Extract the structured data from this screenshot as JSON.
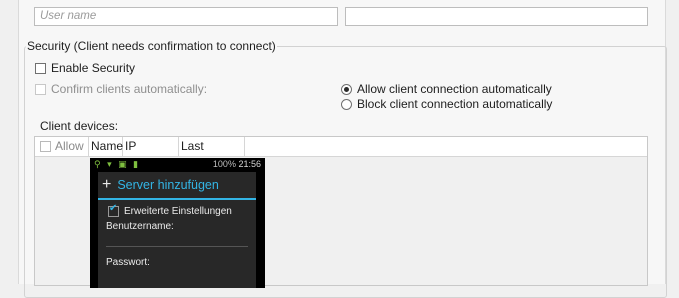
{
  "login": {
    "username_placeholder": "User name",
    "password_value": ""
  },
  "security": {
    "legend": "Security (Client needs confirmation to connect)",
    "enable_label": "Enable Security",
    "confirm_label": "Confirm clients automatically:",
    "radio_allow": "Allow client connection automatically",
    "radio_block": "Block client connection automatically"
  },
  "devices": {
    "label": "Client devices:",
    "columns": [
      "Allow",
      "Name",
      "IP address",
      "Last access"
    ]
  },
  "phone": {
    "time": "21:56",
    "battery": "100%",
    "title": "Server hinzufügen",
    "advanced": "Erweiterte Einstellungen",
    "username": "Benutzername:",
    "password": "Passwort:"
  }
}
